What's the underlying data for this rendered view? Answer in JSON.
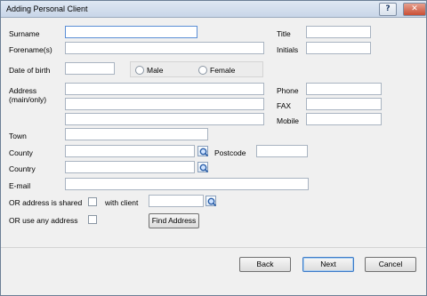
{
  "window": {
    "title": "Adding Personal Client"
  },
  "form": {
    "surname_label": "Surname",
    "forename_label": "Forename(s)",
    "title_label": "Title",
    "initials_label": "Initials",
    "dob_label": "Date of birth",
    "male_label": "Male",
    "female_label": "Female",
    "address_label": "Address",
    "address_sub_label": "(main/only)",
    "phone_label": "Phone",
    "fax_label": "FAX",
    "mobile_label": "Mobile",
    "town_label": "Town",
    "county_label": "County",
    "postcode_label": "Postcode",
    "country_label": "Country",
    "email_label": "E-mail",
    "shared_label": "OR address is shared",
    "with_client_label": "with client",
    "any_address_label": "OR use any address",
    "find_address_label": "Find Address"
  },
  "footer": {
    "back_label": "Back",
    "next_label": "Next",
    "cancel_label": "Cancel"
  },
  "icons": {
    "help": "help-icon",
    "close": "close-icon",
    "lookup": "lookup-icon"
  }
}
